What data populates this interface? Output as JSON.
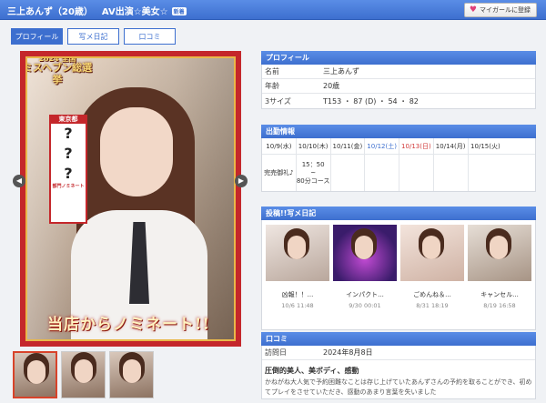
{
  "header": {
    "name": "三上あんず（20歳）",
    "tagline": "AV出演☆美女☆",
    "new_badge": "新着",
    "fav_button": "マイガールに登録"
  },
  "tabs": [
    "プロフィール",
    "写メ日記",
    "口コミ"
  ],
  "photo": {
    "award_year": "2024 全国",
    "award_title": "ミスヘブン総選挙",
    "prefecture": "東京都",
    "marks": [
      "?",
      "?",
      "?"
    ],
    "department": "部門ノミネート",
    "nominate_text": "当店からノミネート!!"
  },
  "profile": {
    "title": "プロフィール",
    "rows": [
      {
        "k": "名前",
        "v": "三上あんず"
      },
      {
        "k": "年齢",
        "v": "20歳"
      },
      {
        "k": "3サイズ",
        "v": "T153 ・ 87 (D) ・ 54 ・ 82"
      }
    ]
  },
  "schedule": {
    "title": "出勤情報",
    "days": [
      {
        "label": "10/9(水)",
        "type": ""
      },
      {
        "label": "10/10(木)",
        "type": ""
      },
      {
        "label": "10/11(金)",
        "type": ""
      },
      {
        "label": "10/12(土)",
        "type": "sat"
      },
      {
        "label": "10/13(日)",
        "type": "hol"
      },
      {
        "label": "10/14(月)",
        "type": ""
      },
      {
        "label": "10/15(火)",
        "type": ""
      }
    ],
    "cells": [
      {
        "l1": "完売御礼♪",
        "l2": "",
        "l3": ""
      },
      {
        "l1": "15：50",
        "l2": "~",
        "l3": "80分コース"
      },
      {
        "l1": "",
        "l2": "",
        "l3": ""
      },
      {
        "l1": "",
        "l2": "",
        "l3": ""
      },
      {
        "l1": "",
        "l2": "",
        "l3": ""
      },
      {
        "l1": "",
        "l2": "",
        "l3": ""
      },
      {
        "l1": "",
        "l2": "",
        "l3": ""
      }
    ]
  },
  "diary": {
    "title": "投稿!!写メ日記",
    "posts": [
      {
        "title": "凶報！！...",
        "date": "10/6 11:48"
      },
      {
        "title": "インパクト...",
        "date": "9/30 00:01"
      },
      {
        "title": "ごめんね＆...",
        "date": "8/31 18:19"
      },
      {
        "title": "キャンセル...",
        "date": "8/19 16:58"
      }
    ]
  },
  "reviews": {
    "title": "口コミ",
    "visit_label": "訪問日",
    "visit_date": "2024年8月8日",
    "review_title": "圧倒的美人、美ボディ、感動",
    "review_text": "かねがね大人気で予約困難なことは存じ上げていたあんずさんの予約を取ることができ、初めてプレイをさせていただき、感動のあまり言葉を失いました"
  },
  "colors": {
    "accent": "#3d6fcf",
    "saturday": "#3d6fcf",
    "holiday": "#d13a3a",
    "frame": "#c4272b"
  },
  "icons": [
    "heart-icon",
    "chevron-left-icon",
    "chevron-right-icon"
  ]
}
